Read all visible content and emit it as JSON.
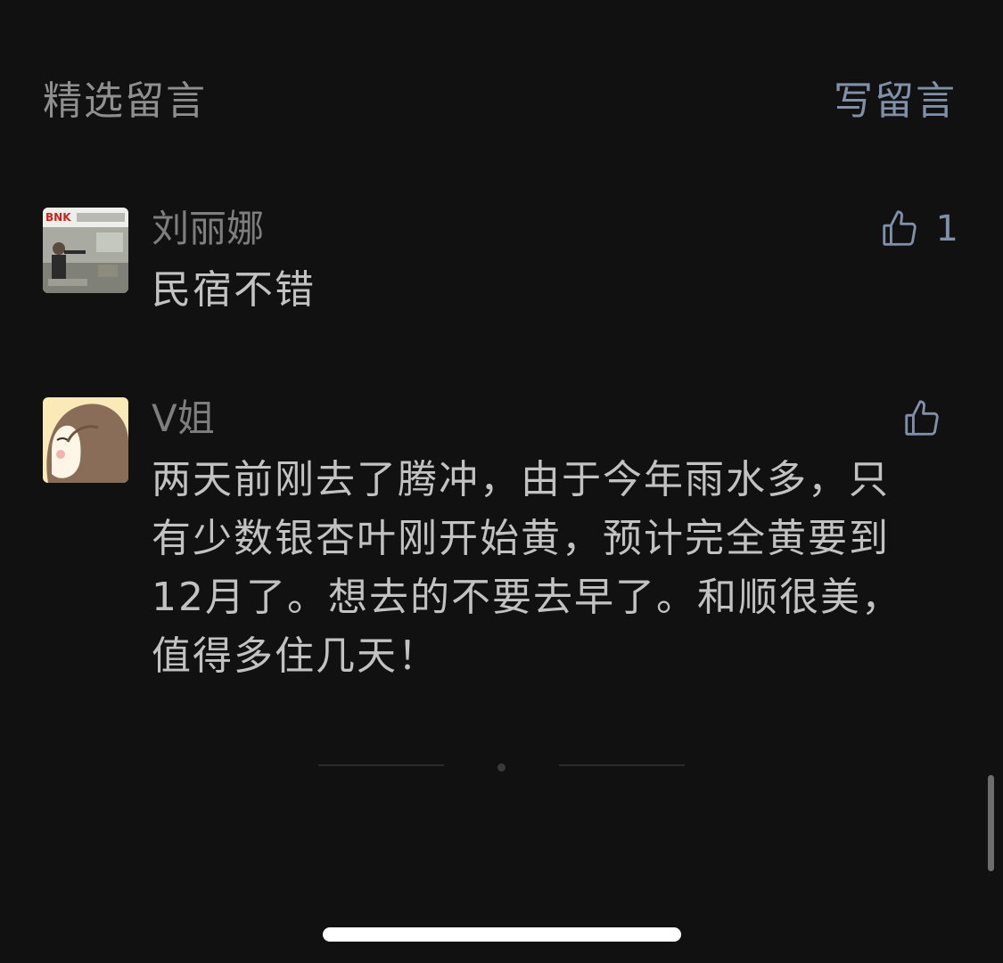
{
  "header": {
    "title": "精选留言",
    "write_label": "写留言"
  },
  "comments": [
    {
      "nickname": "刘丽娜",
      "content": "民宿不错",
      "likes": "1",
      "avatar_sign_text": "BNK 경남은행"
    },
    {
      "nickname": "V姐",
      "content": "两天前刚去了腾冲，由于今年雨水多，只有少数银杏叶刚开始黄，预计完全黄要到12月了。想去的不要去早了。和顺很美，值得多住几天！",
      "likes": ""
    }
  ],
  "icons": {
    "like": "thumbs-up-icon"
  },
  "colors": {
    "background": "#111111",
    "accent": "#8090a8",
    "text": "#c2c2c2",
    "muted": "#7e7e7e"
  }
}
